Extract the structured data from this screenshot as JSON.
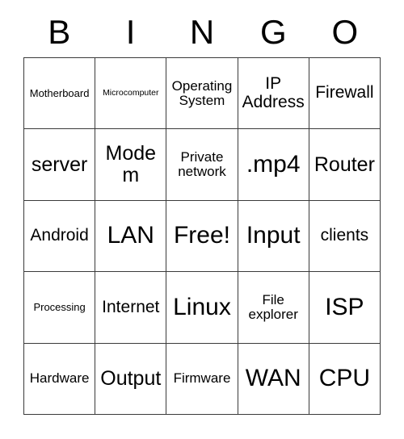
{
  "card": {
    "title": "BINGO",
    "header_letters": [
      "B",
      "I",
      "N",
      "G",
      "O"
    ],
    "free_space": "Free!",
    "rows": 5,
    "columns": 5,
    "border_color": "#3a3a3a",
    "text_color": "#000000",
    "background_color": "#ffffff",
    "cells": [
      [
        {
          "label": "Motherboard",
          "size": "s"
        },
        {
          "label": "Microcomputer",
          "size": "xs"
        },
        {
          "label": "Operating System",
          "size": "m"
        },
        {
          "label": "IP Address",
          "size": "l"
        },
        {
          "label": "Firewall",
          "size": "l"
        }
      ],
      [
        {
          "label": "server",
          "size": "xl"
        },
        {
          "label": "Modem",
          "size": "xl"
        },
        {
          "label": "Private network",
          "size": "m"
        },
        {
          "label": ".mp4",
          "size": "xxl"
        },
        {
          "label": "Router",
          "size": "xl"
        }
      ],
      [
        {
          "label": "Android",
          "size": "l"
        },
        {
          "label": "LAN",
          "size": "xxl"
        },
        {
          "label": "Free!",
          "size": "xxl"
        },
        {
          "label": "Input",
          "size": "xxl"
        },
        {
          "label": "clients",
          "size": "l"
        }
      ],
      [
        {
          "label": "Processing",
          "size": "s"
        },
        {
          "label": "Internet",
          "size": "l"
        },
        {
          "label": "Linux",
          "size": "xxl"
        },
        {
          "label": "File explorer",
          "size": "m"
        },
        {
          "label": "ISP",
          "size": "xxl"
        }
      ],
      [
        {
          "label": "Hardware",
          "size": "m"
        },
        {
          "label": "Output",
          "size": "xl"
        },
        {
          "label": "Firmware",
          "size": "m"
        },
        {
          "label": "WAN",
          "size": "xxl"
        },
        {
          "label": "CPU",
          "size": "xxl"
        }
      ]
    ]
  }
}
